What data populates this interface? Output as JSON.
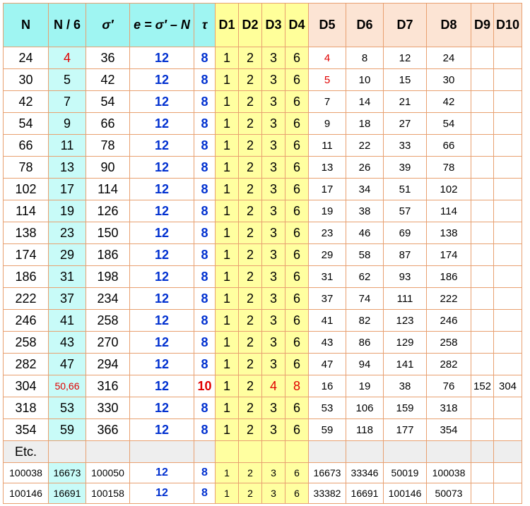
{
  "headers": [
    "N",
    "N / 6",
    "σ′",
    "e = σ′ – N",
    "τ",
    "D1",
    "D2",
    "D3",
    "D4",
    "D5",
    "D6",
    "D7",
    "D8",
    "D9",
    "D10"
  ],
  "rows": [
    [
      "24",
      "4",
      "36",
      "12",
      "8",
      "1",
      "2",
      "3",
      "6",
      "4",
      "8",
      "12",
      "24",
      "",
      ""
    ],
    [
      "30",
      "5",
      "42",
      "12",
      "8",
      "1",
      "2",
      "3",
      "6",
      "5",
      "10",
      "15",
      "30",
      "",
      ""
    ],
    [
      "42",
      "7",
      "54",
      "12",
      "8",
      "1",
      "2",
      "3",
      "6",
      "7",
      "14",
      "21",
      "42",
      "",
      ""
    ],
    [
      "54",
      "9",
      "66",
      "12",
      "8",
      "1",
      "2",
      "3",
      "6",
      "9",
      "18",
      "27",
      "54",
      "",
      ""
    ],
    [
      "66",
      "11",
      "78",
      "12",
      "8",
      "1",
      "2",
      "3",
      "6",
      "11",
      "22",
      "33",
      "66",
      "",
      ""
    ],
    [
      "78",
      "13",
      "90",
      "12",
      "8",
      "1",
      "2",
      "3",
      "6",
      "13",
      "26",
      "39",
      "78",
      "",
      ""
    ],
    [
      "102",
      "17",
      "114",
      "12",
      "8",
      "1",
      "2",
      "3",
      "6",
      "17",
      "34",
      "51",
      "102",
      "",
      ""
    ],
    [
      "114",
      "19",
      "126",
      "12",
      "8",
      "1",
      "2",
      "3",
      "6",
      "19",
      "38",
      "57",
      "114",
      "",
      ""
    ],
    [
      "138",
      "23",
      "150",
      "12",
      "8",
      "1",
      "2",
      "3",
      "6",
      "23",
      "46",
      "69",
      "138",
      "",
      ""
    ],
    [
      "174",
      "29",
      "186",
      "12",
      "8",
      "1",
      "2",
      "3",
      "6",
      "29",
      "58",
      "87",
      "174",
      "",
      ""
    ],
    [
      "186",
      "31",
      "198",
      "12",
      "8",
      "1",
      "2",
      "3",
      "6",
      "31",
      "62",
      "93",
      "186",
      "",
      ""
    ],
    [
      "222",
      "37",
      "234",
      "12",
      "8",
      "1",
      "2",
      "3",
      "6",
      "37",
      "74",
      "111",
      "222",
      "",
      ""
    ],
    [
      "246",
      "41",
      "258",
      "12",
      "8",
      "1",
      "2",
      "3",
      "6",
      "41",
      "82",
      "123",
      "246",
      "",
      ""
    ],
    [
      "258",
      "43",
      "270",
      "12",
      "8",
      "1",
      "2",
      "3",
      "6",
      "43",
      "86",
      "129",
      "258",
      "",
      ""
    ],
    [
      "282",
      "47",
      "294",
      "12",
      "8",
      "1",
      "2",
      "3",
      "6",
      "47",
      "94",
      "141",
      "282",
      "",
      ""
    ],
    [
      "304",
      "50,66",
      "316",
      "12",
      "10",
      "1",
      "2",
      "4",
      "8",
      "16",
      "19",
      "38",
      "76",
      "152",
      "304"
    ],
    [
      "318",
      "53",
      "330",
      "12",
      "8",
      "1",
      "2",
      "3",
      "6",
      "53",
      "106",
      "159",
      "318",
      "",
      ""
    ],
    [
      "354",
      "59",
      "366",
      "12",
      "8",
      "1",
      "2",
      "3",
      "6",
      "59",
      "118",
      "177",
      "354",
      "",
      ""
    ]
  ],
  "etc_label": "Etc.",
  "big_rows": [
    [
      "100038",
      "16673",
      "100050",
      "12",
      "8",
      "1",
      "2",
      "3",
      "6",
      "16673",
      "33346",
      "50019",
      "100038",
      "",
      ""
    ],
    [
      "100146",
      "16691",
      "100158",
      "12",
      "8",
      "1",
      "2",
      "3",
      "6",
      "33382",
      "16691",
      "100146",
      "50073",
      "",
      ""
    ]
  ],
  "highlight": {
    "red_cells": [
      [
        0,
        1
      ],
      [
        0,
        9
      ],
      [
        1,
        9
      ],
      [
        15,
        1
      ],
      [
        15,
        7
      ],
      [
        15,
        8
      ]
    ],
    "red_bold_cells": [
      [
        15,
        4
      ]
    ],
    "text_red": "#e00000",
    "text_blue": "#0030d0",
    "header_cyan": "#9ff5f2",
    "n6_cyan": "#c8fbf8",
    "yellow": "#ffffa0",
    "header_peach": "#fce4d4",
    "border": "#e8a070"
  }
}
